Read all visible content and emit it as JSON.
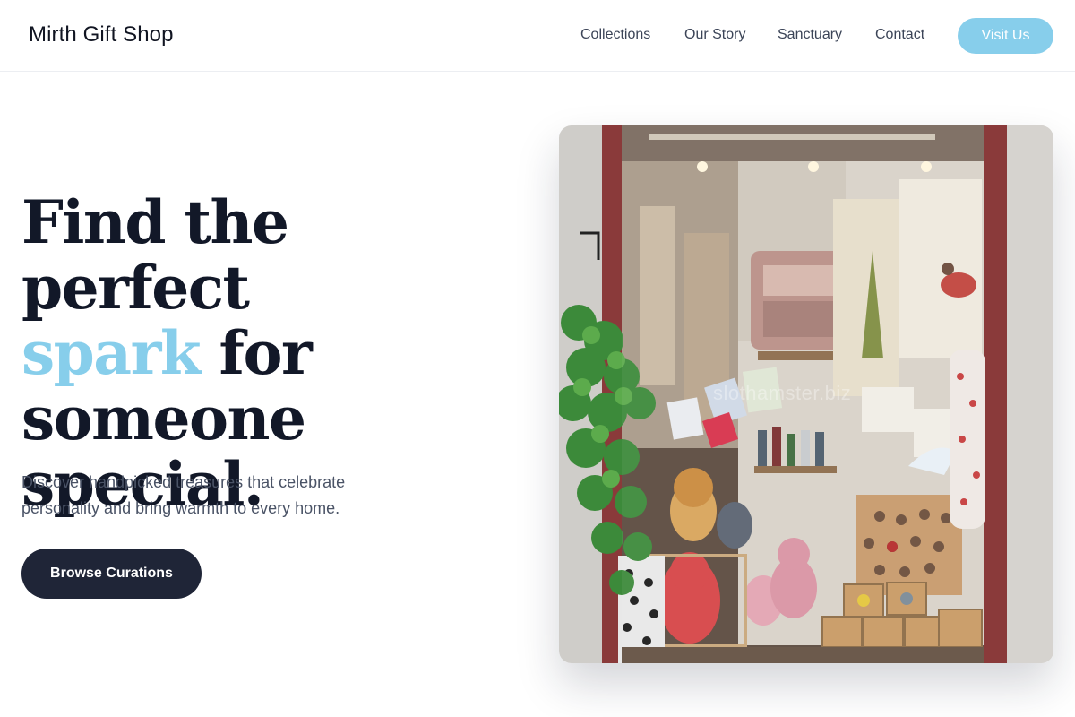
{
  "header": {
    "brand": "Mirth Gift Shop",
    "nav": [
      {
        "label": "Collections"
      },
      {
        "label": "Our Story"
      },
      {
        "label": "Sanctuary"
      },
      {
        "label": "Contact"
      }
    ],
    "cta_label": "Visit Us"
  },
  "hero": {
    "headline": {
      "line1": "Find the perfect",
      "accent": "spark",
      "line2_rest": " for",
      "line3": "someone",
      "line4": "special."
    },
    "subtext": "Discover handpicked treasures that celebrate personality and bring warmth to every home.",
    "cta_label": "Browse Curations",
    "image": {
      "subject": "gift shop window display with plush toys, cushions, wooden birds and climbing ivy",
      "watermark": "slothamster.biz"
    }
  },
  "colors": {
    "accent": "#87ceeb",
    "dark_button": "#1f2537",
    "headline_text": "#121828",
    "body_text": "#4a5366"
  }
}
